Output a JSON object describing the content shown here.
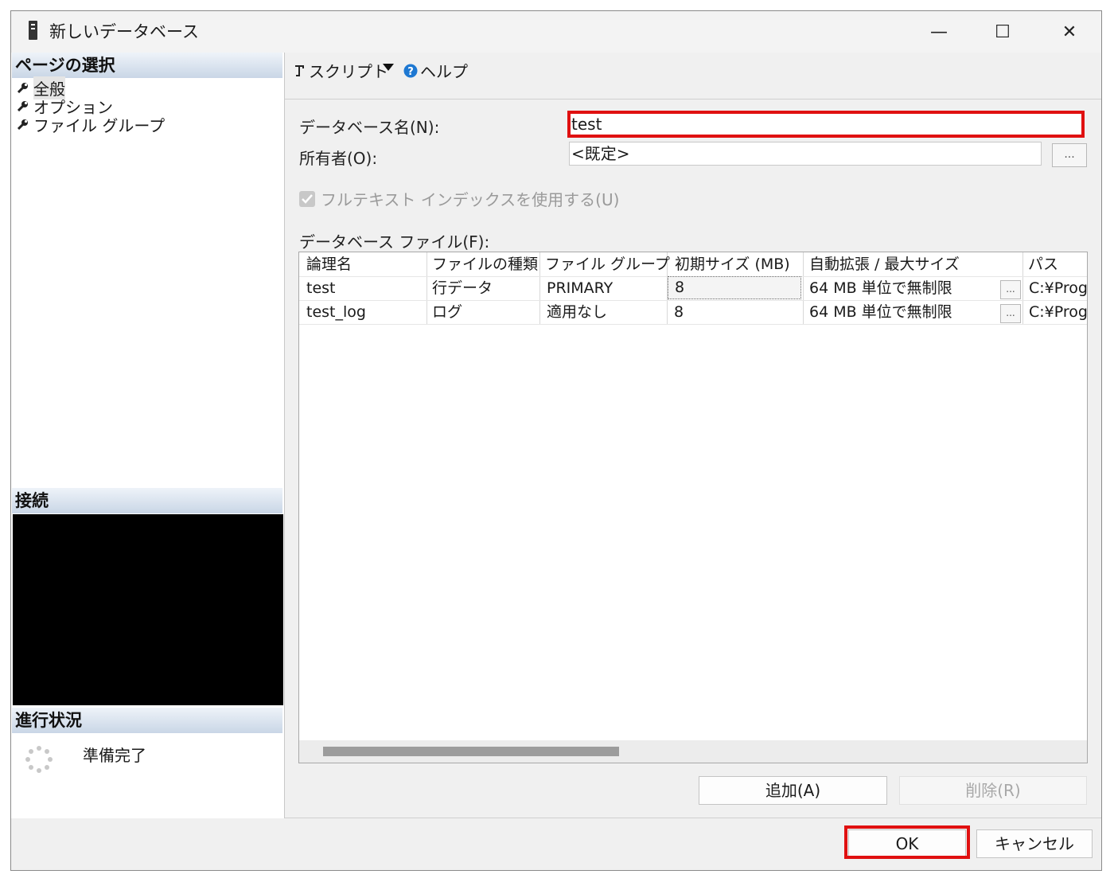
{
  "window": {
    "title": "新しいデータベース",
    "minimize": "—",
    "maximize": "☐",
    "close": "✕"
  },
  "left": {
    "page_select_header": "ページの選択",
    "nav_items": [
      "全般",
      "オプション",
      "ファイル グループ"
    ],
    "connection_header": "接続",
    "progress_header": "進行状況",
    "progress_status": "準備完了"
  },
  "toolbar": {
    "script_label": "スクリプト",
    "help_label": "ヘルプ"
  },
  "form": {
    "db_name_label": "データベース名(N):",
    "db_name_value": "test",
    "owner_label": "所有者(O):",
    "owner_value": "<既定>",
    "owner_browse": "...",
    "fulltext_label": "フルテキスト インデックスを使用する(U)",
    "files_label": "データベース ファイル(F):"
  },
  "grid": {
    "columns": [
      "論理名",
      "ファイルの種類",
      "ファイル グループ",
      "初期サイズ (MB)",
      "自動拡張 / 最大サイズ",
      "パス"
    ],
    "rows": [
      {
        "name": "test",
        "type": "行データ",
        "group": "PRIMARY",
        "size": "8",
        "autogrow": "64 MB 単位で無制限",
        "browse": "...",
        "path": "C:¥Prog"
      },
      {
        "name": "test_log",
        "type": "ログ",
        "group": "適用なし",
        "size": "8",
        "autogrow": "64 MB 単位で無制限",
        "browse": "...",
        "path": "C:¥Prog"
      }
    ]
  },
  "buttons": {
    "add": "追加(A)",
    "remove": "削除(R)",
    "ok": "OK",
    "cancel": "キャンセル"
  },
  "colors": {
    "highlight": "#e01010",
    "section_header": "#c9d6e6",
    "help_icon": "#1e78d2"
  }
}
